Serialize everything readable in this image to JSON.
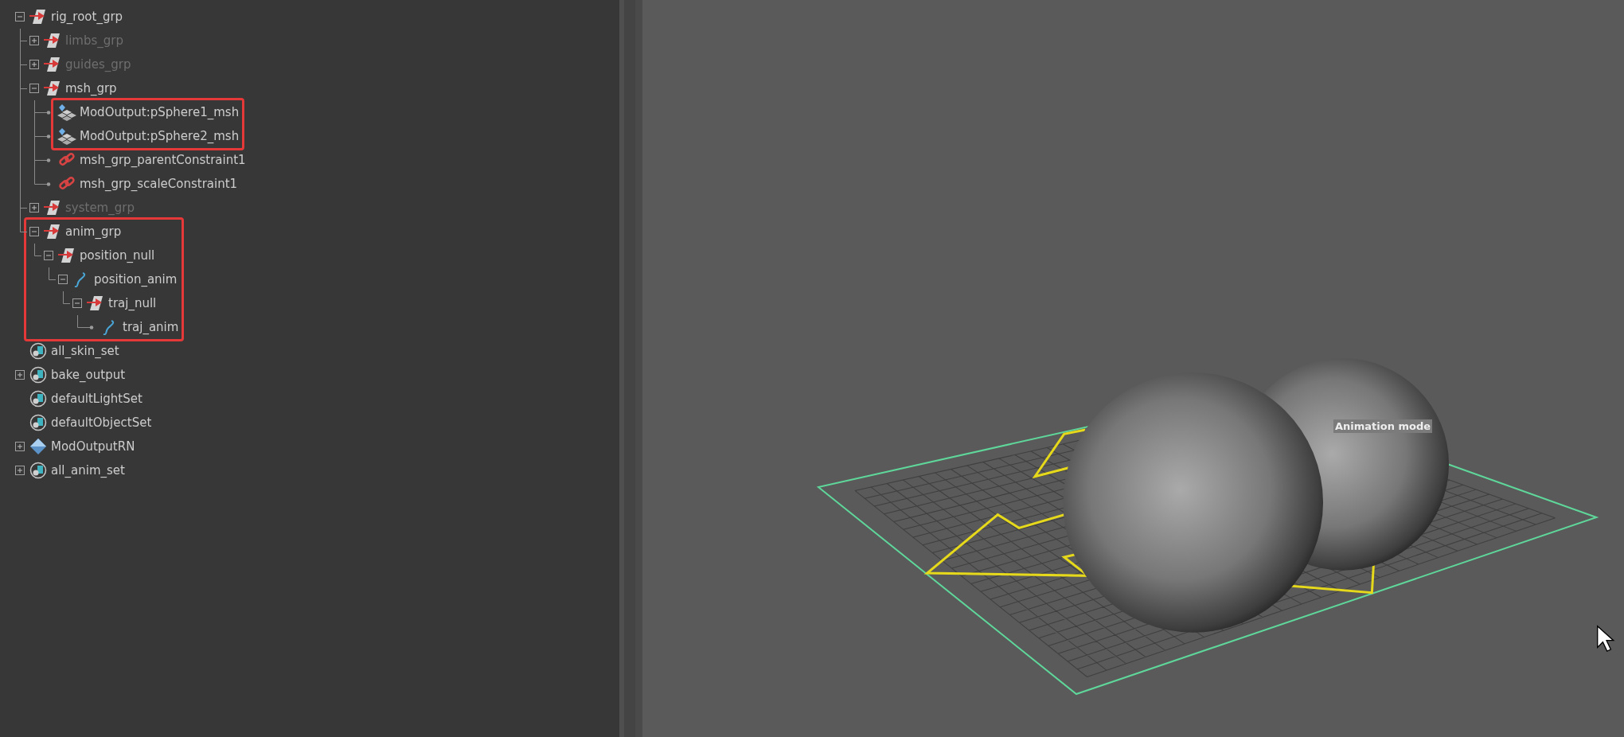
{
  "tree": [
    {
      "label": "rig_root_grp",
      "kind": "transform",
      "expanded": true,
      "children": [
        {
          "label": "limbs_grp",
          "kind": "transform",
          "expanded": false,
          "dimmed": true
        },
        {
          "label": "guides_grp",
          "kind": "transform",
          "expanded": false,
          "dimmed": true
        },
        {
          "label": "msh_grp",
          "kind": "transform",
          "expanded": true,
          "children": [
            {
              "label": "ModOutput:pSphere1_msh",
              "kind": "mesh",
              "highlighted": true
            },
            {
              "label": "ModOutput:pSphere2_msh",
              "kind": "mesh",
              "highlighted": true
            },
            {
              "label": "msh_grp_parentConstraint1",
              "kind": "constraint"
            },
            {
              "label": "msh_grp_scaleConstraint1",
              "kind": "constraint"
            }
          ]
        },
        {
          "label": "system_grp",
          "kind": "transform",
          "expanded": false,
          "dimmed": true
        },
        {
          "label": "anim_grp",
          "kind": "transform",
          "expanded": true,
          "highlighted": true,
          "children": [
            {
              "label": "position_null",
              "kind": "transform",
              "expanded": true,
              "highlighted": true,
              "children": [
                {
                  "label": "position_anim",
                  "kind": "curve",
                  "expanded": true,
                  "highlighted": true,
                  "children": [
                    {
                      "label": "traj_null",
                      "kind": "transform",
                      "expanded": true,
                      "highlighted": true,
                      "children": [
                        {
                          "label": "traj_anim",
                          "kind": "curve",
                          "highlighted": true
                        }
                      ]
                    }
                  ]
                }
              ]
            }
          ]
        }
      ]
    },
    {
      "label": "all_skin_set",
      "kind": "set"
    },
    {
      "label": "bake_output",
      "kind": "set",
      "expanded": false
    },
    {
      "label": "defaultLightSet",
      "kind": "set"
    },
    {
      "label": "defaultObjectSet",
      "kind": "set"
    },
    {
      "label": "ModOutputRN",
      "kind": "reference",
      "expanded": false
    },
    {
      "label": "all_anim_set",
      "kind": "set",
      "expanded": false
    }
  ],
  "viewport": {
    "mode_label": "Animation mode"
  }
}
